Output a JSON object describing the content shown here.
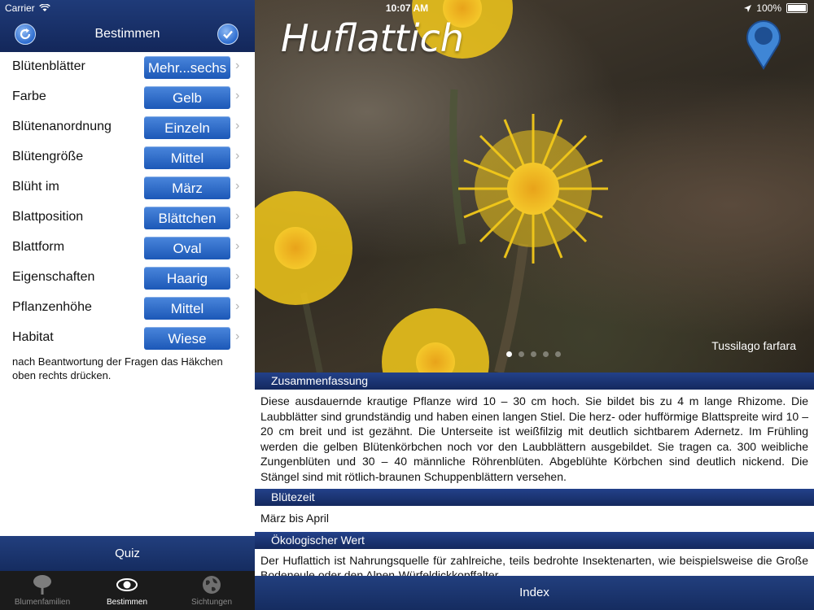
{
  "status": {
    "carrier": "Carrier",
    "time": "10:07 AM",
    "battery": "100%"
  },
  "left": {
    "title": "Bestimmen",
    "rows": [
      {
        "label": "Blütenblätter",
        "value": "Mehr...sechs"
      },
      {
        "label": "Farbe",
        "value": "Gelb"
      },
      {
        "label": "Blütenanordnung",
        "value": "Einzeln"
      },
      {
        "label": "Blütengröße",
        "value": "Mittel"
      },
      {
        "label": "Blüht im",
        "value": "März"
      },
      {
        "label": "Blattposition",
        "value": "Blättchen"
      },
      {
        "label": "Blattform",
        "value": "Oval"
      },
      {
        "label": "Eigenschaften",
        "value": "Haarig"
      },
      {
        "label": "Pflanzenhöhe",
        "value": "Mittel"
      },
      {
        "label": "Habitat",
        "value": "Wiese"
      }
    ],
    "hint": "nach Beantwortung der Fragen das Häkchen oben rechts drücken.",
    "quiz_label": "Quiz",
    "tabs": [
      {
        "label": "Blumenfamilien",
        "icon": "tree-icon",
        "active": false
      },
      {
        "label": "Bestimmen",
        "icon": "eye-icon",
        "active": true
      },
      {
        "label": "Sichtungen",
        "icon": "globe-icon",
        "active": false
      }
    ]
  },
  "hero": {
    "plant_name": "Huflattich",
    "latin_name": "Tussilago farfara",
    "page_count": 5,
    "active_page": 1
  },
  "sections": [
    {
      "heading": "Zusammenfassung",
      "text": "Diese ausdauernde krautige Pflanze wird 10 – 30 cm hoch. Sie bildet bis zu 4 m lange Rhizome. Die Laubblätter sind grundständig und haben einen langen Stiel. Die herz- oder hufförmige Blattspreite wird 10 – 20 cm breit und ist gezähnt. Die Unterseite ist weißfilzig mit deutlich sichtbarem Adernetz. Im Frühling werden die gelben Blütenkörbchen noch vor den Laubblättern ausgebildet. Sie tragen ca. 300 weibliche Zungenblüten und 30 – 40 männliche Röhrenblüten. Abgeblühte Körbchen sind deutlich nickend. Die Stängel sind mit rötlich-braunen Schuppenblättern versehen."
    },
    {
      "heading": "Blütezeit",
      "text": "März bis April"
    },
    {
      "heading": "Ökologischer Wert",
      "text": "Der Huflattich ist Nahrungsquelle für zahlreiche, teils bedrohte Insektenarten, wie beispielsweise die Große Bodeneule oder den Alpen-Würfeldickkopffalter."
    }
  ],
  "index_label": "Index",
  "colors": {
    "nav": "#1b3370",
    "button": "#2a66c6",
    "flower": "#f2c81a"
  }
}
